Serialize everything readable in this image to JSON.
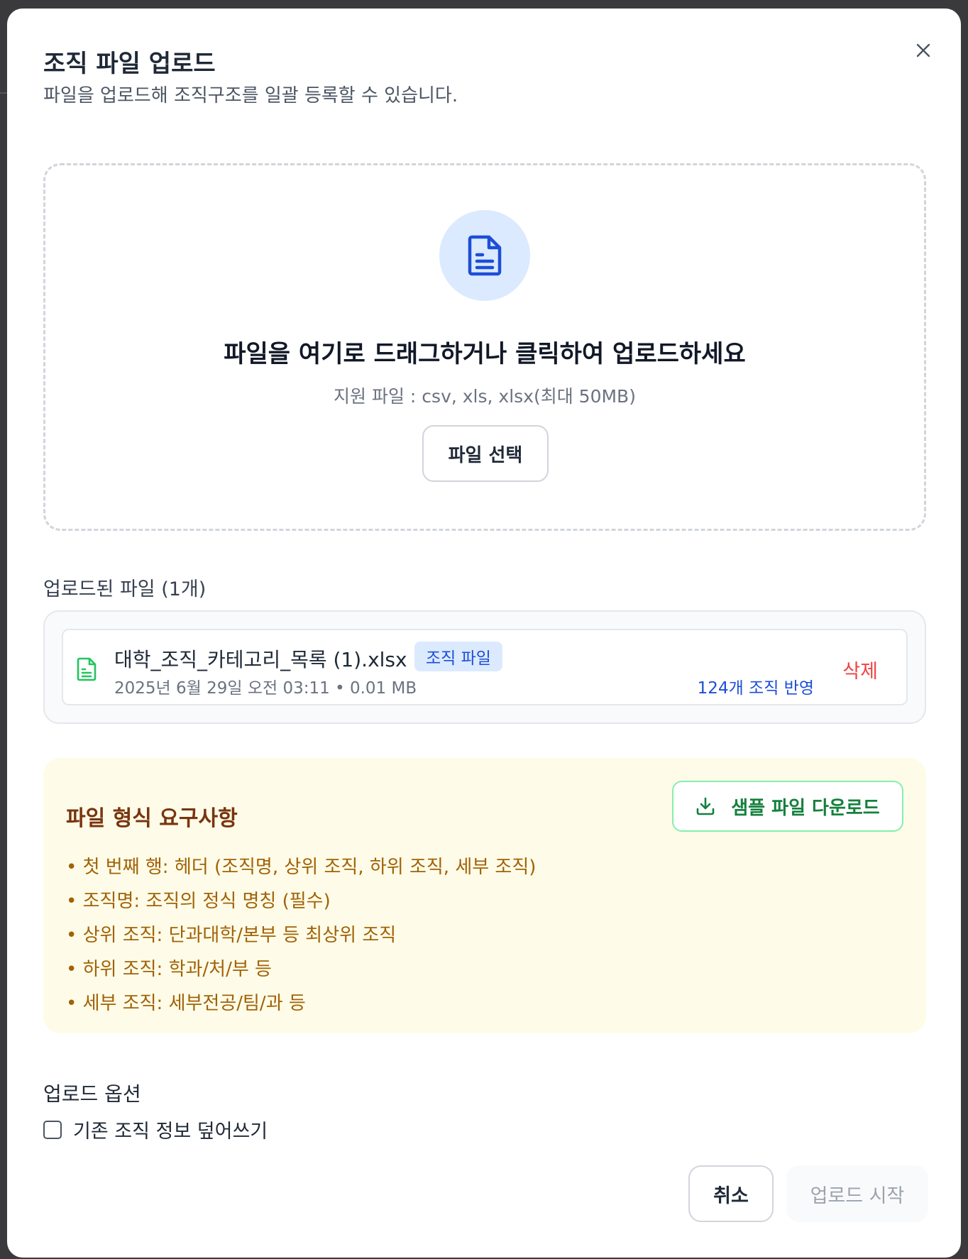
{
  "modal": {
    "title": "조직 파일 업로드",
    "subtitle": "파일을 업로드해 조직구조를 일괄 등록할 수 있습니다.",
    "close_icon": "close-icon"
  },
  "dropzone": {
    "icon": "document-icon",
    "headline": "파일을 여기로 드래그하거나 클릭하여 업로드하세요",
    "hint": "지원 파일 : csv, xls, xlsx(최대 50MB)",
    "choose_button": "파일 선택"
  },
  "uploaded": {
    "heading": "업로드된 파일 (1개)",
    "files": [
      {
        "name": "대학_조직_카테고리_목록 (1).xlsx",
        "tag": "조직 파일",
        "meta": "2025년 6월 29일 오전 03:11 • 0.01 MB",
        "result": "124개 조직 반영",
        "delete_label": "삭제",
        "icon": "spreadsheet-file-icon"
      }
    ]
  },
  "requirements": {
    "title": "파일 형식 요구사항",
    "sample_button": "샘플 파일 다운로드",
    "sample_icon": "download-icon",
    "items": [
      "• 첫 번째 행: 헤더 (조직명, 상위 조직, 하위 조직, 세부 조직)",
      "• 조직명: 조직의 정식 명칭 (필수)",
      "• 상위 조직: 단과대학/본부 등 최상위 조직",
      "• 하위 조직: 학과/처/부 등",
      "• 세부 조직: 세부전공/팀/과 등"
    ]
  },
  "options": {
    "heading": "업로드 옵션",
    "overwrite_label": "기존 조직 정보 덮어쓰기",
    "overwrite_checked": false
  },
  "footer": {
    "cancel_label": "취소",
    "start_label": "업로드 시작"
  },
  "colors": {
    "accent_blue": "#1d4ed8",
    "danger": "#ef4444",
    "success": "#15803d",
    "warning_bg": "#fefce8",
    "warning_text": "#a16207"
  }
}
